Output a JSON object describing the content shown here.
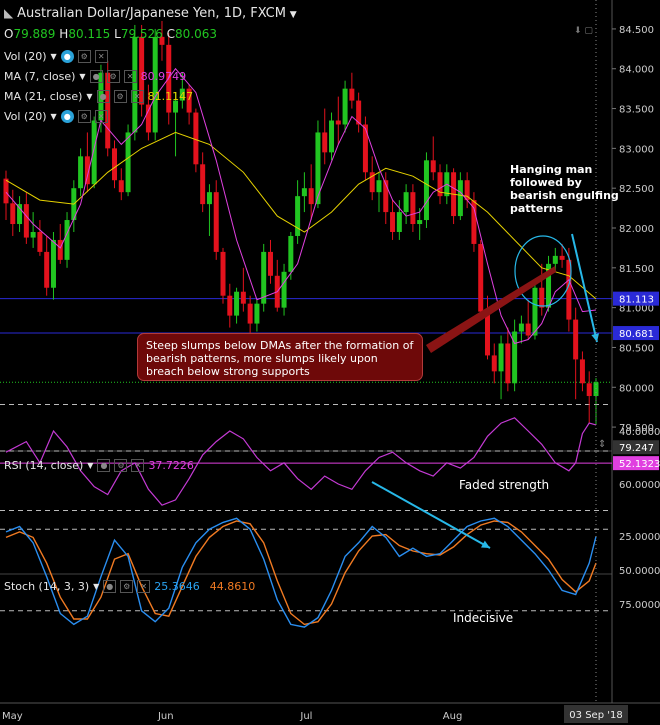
{
  "header": {
    "symbol": "Australian Dollar/Japanese Yen, 1D, FXCM",
    "ohlc": [
      {
        "k": "O",
        "v": "79.889"
      },
      {
        "k": "H",
        "v": "80.115"
      },
      {
        "k": "L",
        "v": "79.526"
      },
      {
        "k": "C",
        "v": "80.063"
      }
    ]
  },
  "indicators": [
    {
      "label": "Vol (20)",
      "value": "",
      "color": "#e6e6e6"
    },
    {
      "label": "MA (7, close)",
      "value": "80.9749",
      "color": "#e040e0"
    },
    {
      "label": "MA (21, close)",
      "value": "81.1147",
      "color": "#e6d200"
    },
    {
      "label": "Vol (20)",
      "value": "",
      "color": "#e6e6e6"
    }
  ],
  "rsi_legend": {
    "label": "RSI (14, close)",
    "value": "37.7226"
  },
  "stoch_legend": {
    "label": "Stoch (14, 3, 3)",
    "k": "25.3646",
    "d": "44.8610"
  },
  "price_axis": {
    "ticks": [
      "84.500",
      "84.000",
      "83.500",
      "83.000",
      "82.500",
      "82.000",
      "81.500",
      "81.000",
      "80.500",
      "80.000",
      "79.500"
    ],
    "badges": [
      {
        "label": "81.113",
        "color": "#2a2ad6"
      },
      {
        "label": "80.681",
        "color": "#2a2ad6"
      },
      {
        "label": "79.247",
        "color": "#333"
      }
    ]
  },
  "rsi_axis": {
    "ticks": [
      "60.0000",
      "40.0000"
    ],
    "badge": "52.1323",
    "badge_color": "#e040e0"
  },
  "stoch_axis": {
    "ticks": [
      "75.0000",
      "50.0000",
      "25.0000"
    ]
  },
  "x_axis": {
    "ticks": [
      "May",
      "Jun",
      "Jul",
      "Aug"
    ],
    "cursor_label": "03 Sep '18"
  },
  "annotations": {
    "hanging_man": "Hanging man followed by bearish engulfing patterns",
    "steep_slumps": "Steep slumps below DMAs after the formation of bearish patterns, more slumps likely upon breach below strong supports",
    "rsi_note": "Faded strength",
    "stoch_note": "Indecisive"
  },
  "colors": {
    "bull": "#21c521",
    "bear": "#e3121d",
    "ma7": "#e040e0",
    "ma21": "#e6d200",
    "support": "#2a2ad6",
    "arrow": "#27b8e8"
  },
  "chart_data": {
    "type": "candlestick",
    "title": "Australian Dollar/Japanese Yen, 1D, FXCM",
    "ylim": [
      79.25,
      84.7
    ],
    "support_levels": [
      81.113,
      80.681
    ],
    "last_close": 80.063,
    "candles": [
      [
        82.62,
        82.72,
        82.1,
        82.31
      ],
      [
        82.31,
        82.48,
        81.9,
        82.05
      ],
      [
        82.05,
        82.4,
        81.95,
        82.3
      ],
      [
        82.3,
        82.45,
        81.8,
        81.88
      ],
      [
        81.88,
        82.2,
        81.75,
        81.95
      ],
      [
        81.95,
        82.1,
        81.65,
        81.7
      ],
      [
        81.7,
        81.9,
        81.15,
        81.25
      ],
      [
        81.25,
        81.95,
        81.1,
        81.85
      ],
      [
        81.85,
        82.05,
        81.55,
        81.6
      ],
      [
        81.6,
        82.2,
        81.5,
        82.1
      ],
      [
        82.1,
        82.6,
        81.95,
        82.5
      ],
      [
        82.5,
        83.0,
        82.4,
        82.9
      ],
      [
        82.9,
        83.2,
        82.45,
        82.55
      ],
      [
        82.55,
        83.4,
        82.5,
        83.35
      ],
      [
        83.35,
        84.05,
        83.2,
        83.95
      ],
      [
        83.95,
        84.1,
        82.9,
        83.0
      ],
      [
        83.0,
        83.1,
        82.5,
        82.6
      ],
      [
        82.6,
        82.75,
        82.35,
        82.45
      ],
      [
        82.45,
        83.3,
        82.4,
        83.2
      ],
      [
        83.2,
        84.55,
        83.1,
        84.4
      ],
      [
        84.4,
        84.55,
        83.4,
        83.55
      ],
      [
        83.55,
        83.8,
        83.1,
        83.2
      ],
      [
        83.2,
        84.5,
        83.1,
        84.4
      ],
      [
        84.4,
        84.6,
        84.1,
        84.3
      ],
      [
        84.3,
        84.45,
        83.3,
        83.45
      ],
      [
        83.45,
        83.7,
        82.9,
        83.6
      ],
      [
        83.6,
        83.95,
        83.5,
        83.75
      ],
      [
        83.75,
        83.8,
        83.3,
        83.45
      ],
      [
        83.45,
        83.5,
        82.7,
        82.8
      ],
      [
        82.8,
        82.95,
        82.2,
        82.3
      ],
      [
        82.3,
        82.55,
        81.9,
        82.45
      ],
      [
        82.45,
        82.6,
        81.6,
        81.7
      ],
      [
        81.7,
        81.75,
        81.05,
        81.15
      ],
      [
        81.15,
        81.3,
        80.75,
        80.9
      ],
      [
        80.9,
        81.25,
        80.8,
        81.2
      ],
      [
        81.2,
        81.5,
        80.95,
        81.05
      ],
      [
        81.05,
        81.15,
        80.65,
        80.8
      ],
      [
        80.8,
        81.1,
        80.7,
        81.05
      ],
      [
        81.05,
        81.8,
        80.95,
        81.7
      ],
      [
        81.7,
        81.85,
        81.3,
        81.4
      ],
      [
        81.4,
        81.6,
        80.95,
        81.0
      ],
      [
        81.0,
        81.55,
        80.9,
        81.45
      ],
      [
        81.45,
        81.95,
        81.35,
        81.9
      ],
      [
        81.9,
        82.6,
        81.8,
        82.4
      ],
      [
        82.4,
        82.7,
        82.2,
        82.5
      ],
      [
        82.5,
        82.8,
        82.1,
        82.3
      ],
      [
        82.3,
        83.35,
        82.25,
        83.2
      ],
      [
        83.2,
        83.5,
        82.8,
        82.95
      ],
      [
        82.95,
        83.45,
        82.85,
        83.35
      ],
      [
        83.35,
        83.65,
        83.05,
        83.3
      ],
      [
        83.3,
        83.85,
        83.2,
        83.75
      ],
      [
        83.75,
        83.95,
        83.5,
        83.6
      ],
      [
        83.6,
        83.7,
        83.2,
        83.3
      ],
      [
        83.3,
        83.4,
        82.6,
        82.7
      ],
      [
        82.7,
        82.9,
        82.35,
        82.45
      ],
      [
        82.45,
        82.7,
        82.2,
        82.6
      ],
      [
        82.6,
        82.7,
        82.05,
        82.2
      ],
      [
        82.2,
        82.35,
        81.85,
        81.95
      ],
      [
        81.95,
        82.35,
        81.85,
        82.2
      ],
      [
        82.2,
        82.55,
        82.05,
        82.45
      ],
      [
        82.45,
        82.55,
        81.95,
        82.05
      ],
      [
        82.05,
        82.25,
        81.85,
        82.1
      ],
      [
        82.1,
        82.95,
        82.0,
        82.85
      ],
      [
        82.85,
        83.15,
        82.6,
        82.7
      ],
      [
        82.7,
        82.8,
        82.3,
        82.4
      ],
      [
        82.4,
        82.8,
        82.3,
        82.7
      ],
      [
        82.7,
        82.75,
        82.05,
        82.15
      ],
      [
        82.15,
        82.7,
        82.1,
        82.6
      ],
      [
        82.6,
        82.7,
        82.25,
        82.35
      ],
      [
        82.35,
        82.45,
        81.7,
        81.8
      ],
      [
        81.8,
        81.85,
        80.85,
        80.95
      ],
      [
        80.95,
        81.15,
        80.35,
        80.4
      ],
      [
        80.4,
        80.55,
        80.05,
        80.2
      ],
      [
        80.2,
        80.65,
        79.85,
        80.55
      ],
      [
        80.55,
        80.75,
        79.95,
        80.05
      ],
      [
        80.05,
        80.85,
        79.95,
        80.7
      ],
      [
        80.7,
        80.9,
        80.55,
        80.8
      ],
      [
        80.8,
        81.1,
        80.6,
        80.65
      ],
      [
        80.65,
        81.35,
        80.6,
        81.25
      ],
      [
        81.25,
        81.55,
        80.9,
        81.0
      ],
      [
        81.0,
        81.65,
        80.95,
        81.55
      ],
      [
        81.55,
        81.75,
        81.45,
        81.65
      ],
      [
        81.65,
        81.8,
        81.5,
        81.6
      ],
      [
        81.6,
        81.75,
        80.7,
        80.85
      ],
      [
        80.85,
        81.0,
        79.85,
        80.35
      ],
      [
        80.35,
        80.45,
        79.95,
        80.05
      ],
      [
        80.05,
        80.2,
        79.55,
        79.89
      ],
      [
        79.89,
        80.115,
        79.526,
        80.063
      ]
    ],
    "ma7": [
      [
        0,
        82.45
      ],
      [
        4,
        82.05
      ],
      [
        8,
        81.75
      ],
      [
        11,
        82.3
      ],
      [
        14,
        83.35
      ],
      [
        17,
        83.05
      ],
      [
        20,
        83.3
      ],
      [
        22,
        83.65
      ],
      [
        25,
        84.0
      ],
      [
        28,
        83.7
      ],
      [
        31,
        82.85
      ],
      [
        34,
        81.85
      ],
      [
        37,
        81.1
      ],
      [
        40,
        81.2
      ],
      [
        43,
        81.55
      ],
      [
        46,
        82.4
      ],
      [
        49,
        83.05
      ],
      [
        51,
        83.4
      ],
      [
        53,
        83.25
      ],
      [
        55,
        82.75
      ],
      [
        57,
        82.35
      ],
      [
        59,
        82.15
      ],
      [
        61,
        82.2
      ],
      [
        63,
        82.45
      ],
      [
        65,
        82.55
      ],
      [
        67,
        82.45
      ],
      [
        69,
        82.25
      ],
      [
        71,
        81.55
      ],
      [
        73,
        80.9
      ],
      [
        75,
        80.55
      ],
      [
        77,
        80.6
      ],
      [
        79,
        80.8
      ],
      [
        81,
        81.2
      ],
      [
        83,
        81.35
      ],
      [
        85,
        80.95
      ],
      [
        87,
        80.97
      ]
    ],
    "ma21": [
      [
        0,
        82.6
      ],
      [
        5,
        82.35
      ],
      [
        10,
        82.3
      ],
      [
        15,
        82.7
      ],
      [
        20,
        83.0
      ],
      [
        25,
        83.2
      ],
      [
        30,
        83.05
      ],
      [
        35,
        82.7
      ],
      [
        40,
        82.15
      ],
      [
        44,
        81.95
      ],
      [
        48,
        82.2
      ],
      [
        52,
        82.55
      ],
      [
        56,
        82.75
      ],
      [
        60,
        82.65
      ],
      [
        64,
        82.45
      ],
      [
        68,
        82.4
      ],
      [
        71,
        82.2
      ],
      [
        75,
        81.85
      ],
      [
        79,
        81.5
      ],
      [
        83,
        81.4
      ],
      [
        87,
        81.11
      ]
    ],
    "rsi": [
      [
        0,
        48
      ],
      [
        3,
        44
      ],
      [
        5,
        52
      ],
      [
        7,
        40
      ],
      [
        9,
        46
      ],
      [
        11,
        55
      ],
      [
        13,
        61
      ],
      [
        15,
        64
      ],
      [
        17,
        55
      ],
      [
        19,
        52
      ],
      [
        21,
        62
      ],
      [
        23,
        68
      ],
      [
        25,
        66
      ],
      [
        27,
        58
      ],
      [
        29,
        49
      ],
      [
        31,
        44
      ],
      [
        33,
        40
      ],
      [
        35,
        43
      ],
      [
        37,
        50
      ],
      [
        39,
        55
      ],
      [
        41,
        52
      ],
      [
        43,
        58
      ],
      [
        45,
        62
      ],
      [
        47,
        57
      ],
      [
        49,
        60
      ],
      [
        51,
        62
      ],
      [
        53,
        55
      ],
      [
        55,
        50
      ],
      [
        57,
        48
      ],
      [
        59,
        52
      ],
      [
        61,
        55
      ],
      [
        63,
        57
      ],
      [
        65,
        52
      ],
      [
        67,
        54
      ],
      [
        69,
        50
      ],
      [
        71,
        42
      ],
      [
        73,
        37
      ],
      [
        75,
        35
      ],
      [
        77,
        40
      ],
      [
        79,
        45
      ],
      [
        81,
        52
      ],
      [
        83,
        55
      ],
      [
        84,
        52
      ],
      [
        85,
        41
      ],
      [
        86,
        37
      ],
      [
        87,
        37.7
      ]
    ],
    "stoch_k": [
      [
        0,
        22
      ],
      [
        2,
        18
      ],
      [
        4,
        30
      ],
      [
        6,
        55
      ],
      [
        8,
        82
      ],
      [
        10,
        90
      ],
      [
        12,
        84
      ],
      [
        14,
        55
      ],
      [
        16,
        28
      ],
      [
        18,
        40
      ],
      [
        20,
        80
      ],
      [
        22,
        88
      ],
      [
        24,
        78
      ],
      [
        26,
        48
      ],
      [
        28,
        30
      ],
      [
        30,
        20
      ],
      [
        32,
        15
      ],
      [
        34,
        12
      ],
      [
        36,
        20
      ],
      [
        38,
        42
      ],
      [
        40,
        72
      ],
      [
        42,
        90
      ],
      [
        44,
        92
      ],
      [
        46,
        85
      ],
      [
        48,
        65
      ],
      [
        50,
        40
      ],
      [
        52,
        30
      ],
      [
        54,
        18
      ],
      [
        56,
        26
      ],
      [
        58,
        40
      ],
      [
        60,
        34
      ],
      [
        62,
        40
      ],
      [
        64,
        38
      ],
      [
        66,
        28
      ],
      [
        68,
        18
      ],
      [
        70,
        14
      ],
      [
        72,
        12
      ],
      [
        74,
        18
      ],
      [
        76,
        28
      ],
      [
        78,
        38
      ],
      [
        80,
        50
      ],
      [
        82,
        65
      ],
      [
        84,
        68
      ],
      [
        86,
        45
      ],
      [
        87,
        25.4
      ]
    ],
    "stoch_d": [
      [
        0,
        26
      ],
      [
        2,
        22
      ],
      [
        4,
        26
      ],
      [
        6,
        45
      ],
      [
        8,
        70
      ],
      [
        10,
        86
      ],
      [
        12,
        86
      ],
      [
        14,
        70
      ],
      [
        16,
        42
      ],
      [
        18,
        38
      ],
      [
        20,
        62
      ],
      [
        22,
        82
      ],
      [
        24,
        84
      ],
      [
        26,
        62
      ],
      [
        28,
        40
      ],
      [
        30,
        26
      ],
      [
        32,
        18
      ],
      [
        34,
        14
      ],
      [
        36,
        16
      ],
      [
        38,
        30
      ],
      [
        40,
        58
      ],
      [
        42,
        82
      ],
      [
        44,
        90
      ],
      [
        46,
        88
      ],
      [
        48,
        75
      ],
      [
        50,
        52
      ],
      [
        52,
        36
      ],
      [
        54,
        25
      ],
      [
        56,
        24
      ],
      [
        58,
        32
      ],
      [
        60,
        36
      ],
      [
        62,
        38
      ],
      [
        64,
        39
      ],
      [
        66,
        33
      ],
      [
        68,
        24
      ],
      [
        70,
        17
      ],
      [
        72,
        14
      ],
      [
        74,
        15
      ],
      [
        76,
        22
      ],
      [
        78,
        32
      ],
      [
        80,
        42
      ],
      [
        82,
        57
      ],
      [
        84,
        66
      ],
      [
        86,
        58
      ],
      [
        87,
        44.9
      ]
    ]
  }
}
